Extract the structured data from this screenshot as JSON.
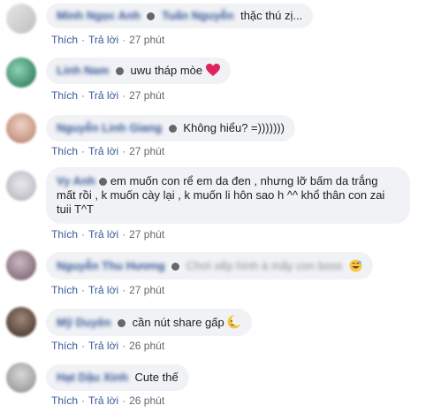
{
  "comments": [
    {
      "author": "Minh Ngọc Anh",
      "author_extra": "Tuấn Nguyễn",
      "text": "thặc thú zị...",
      "like": "Thích",
      "reply": "Trả lời",
      "time": "27 phút"
    },
    {
      "author": "Linh Nam",
      "text": "uwu tháp mòe",
      "like": "Thích",
      "reply": "Trả lời",
      "time": "27 phút"
    },
    {
      "author": "Nguyễn Linh Giang",
      "text": "Không hiểu? =)))))))",
      "like": "Thích",
      "reply": "Trả lời",
      "time": "27 phút"
    },
    {
      "author": "Vy Anh",
      "text": "em muốn con rể em da đen , nhưng lỡ bấm da trắng mất rồi , k muốn cày lại , k muốn li hôn sao h ^^ khổ thân con zai tuii T^T",
      "like": "Thích",
      "reply": "Trả lời",
      "time": "27 phút"
    },
    {
      "author": "Nguyễn Thu Hương",
      "blurred_text": "Chơi xếp hình à mấy con boss",
      "like": "Thích",
      "reply": "Trả lời",
      "time": "27 phút"
    },
    {
      "author": "Mỹ Duyên",
      "text": "cần nút share gấp",
      "like": "Thích",
      "reply": "Trả lời",
      "time": "26 phút"
    },
    {
      "author": "Hạt Dậu Xinh",
      "text": "Cute thế",
      "like": "Thích",
      "reply": "Trả lời",
      "time": "26 phút"
    }
  ],
  "colors": {
    "bubble": "#f0f2f5",
    "link": "#385898",
    "meta": "#65676b"
  },
  "icons": [
    "heart-face-emoji",
    "laugh-sweat-emoji",
    "moon-emoji"
  ]
}
